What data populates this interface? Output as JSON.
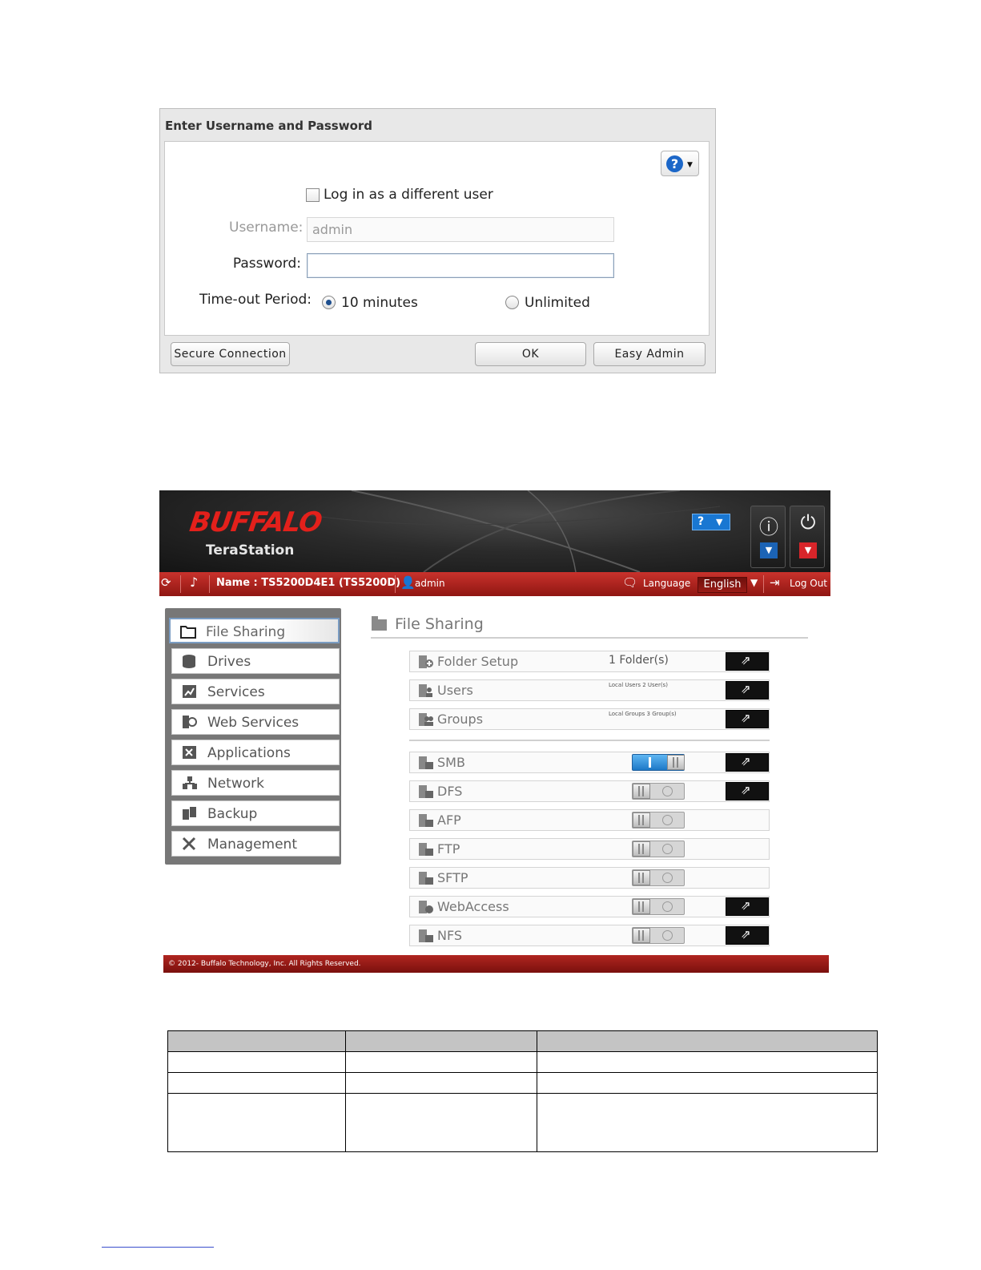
{
  "login": {
    "title": "Enter Username and Password",
    "help_icon": "question-icon",
    "different_user_label": "Log in as a different user",
    "username_label": "Username:",
    "username_value": "admin",
    "password_label": "Password:",
    "password_value": "",
    "timeout_label": "Time-out Period:",
    "timeout_options": [
      "10 minutes",
      "Unlimited"
    ],
    "timeout_selected": "10 minutes",
    "buttons": {
      "secure": "Secure Connection",
      "ok": "OK",
      "easy_admin": "Easy Admin"
    }
  },
  "nas": {
    "brand": "BUFFALO",
    "product": "TeraStation",
    "help_button": "?",
    "bar": {
      "name": "Name : TS5200D4E1 (TS5200D)",
      "user": "admin",
      "language_label": "Language",
      "language_value": "English",
      "logout": "Log Out"
    },
    "sidebar": [
      {
        "label": "File Sharing",
        "icon": "folder-icon",
        "active": true
      },
      {
        "label": "Drives",
        "icon": "drive-icon"
      },
      {
        "label": "Services",
        "icon": "services-icon"
      },
      {
        "label": "Web Services",
        "icon": "web-services-icon"
      },
      {
        "label": "Applications",
        "icon": "applications-icon"
      },
      {
        "label": "Network",
        "icon": "network-icon"
      },
      {
        "label": "Backup",
        "icon": "backup-icon"
      },
      {
        "label": "Management",
        "icon": "wrench-icon"
      }
    ],
    "panel_title": "File Sharing",
    "items": [
      {
        "label": "Folder Setup",
        "value": "1 Folder(s)",
        "link": true
      },
      {
        "label": "Users",
        "value": "Local Users 2 User(s)",
        "link": true
      },
      {
        "label": "Groups",
        "value": "Local Groups 3 Group(s)",
        "link": true
      }
    ],
    "services": [
      {
        "label": "SMB",
        "enabled": true,
        "link": true
      },
      {
        "label": "DFS",
        "enabled": false,
        "link": true
      },
      {
        "label": "AFP",
        "enabled": false,
        "link": false
      },
      {
        "label": "FTP",
        "enabled": false,
        "link": false
      },
      {
        "label": "SFTP",
        "enabled": false,
        "link": false
      },
      {
        "label": "WebAccess",
        "enabled": false,
        "link": true
      },
      {
        "label": "NFS",
        "enabled": false,
        "link": true
      }
    ],
    "footer": "© 2012- Buffalo Technology, Inc. All Rights Reserved."
  },
  "colors": {
    "brand_red": "#e3201b",
    "bar_red": "#b02520",
    "toggle_on": "#1c78c7"
  }
}
